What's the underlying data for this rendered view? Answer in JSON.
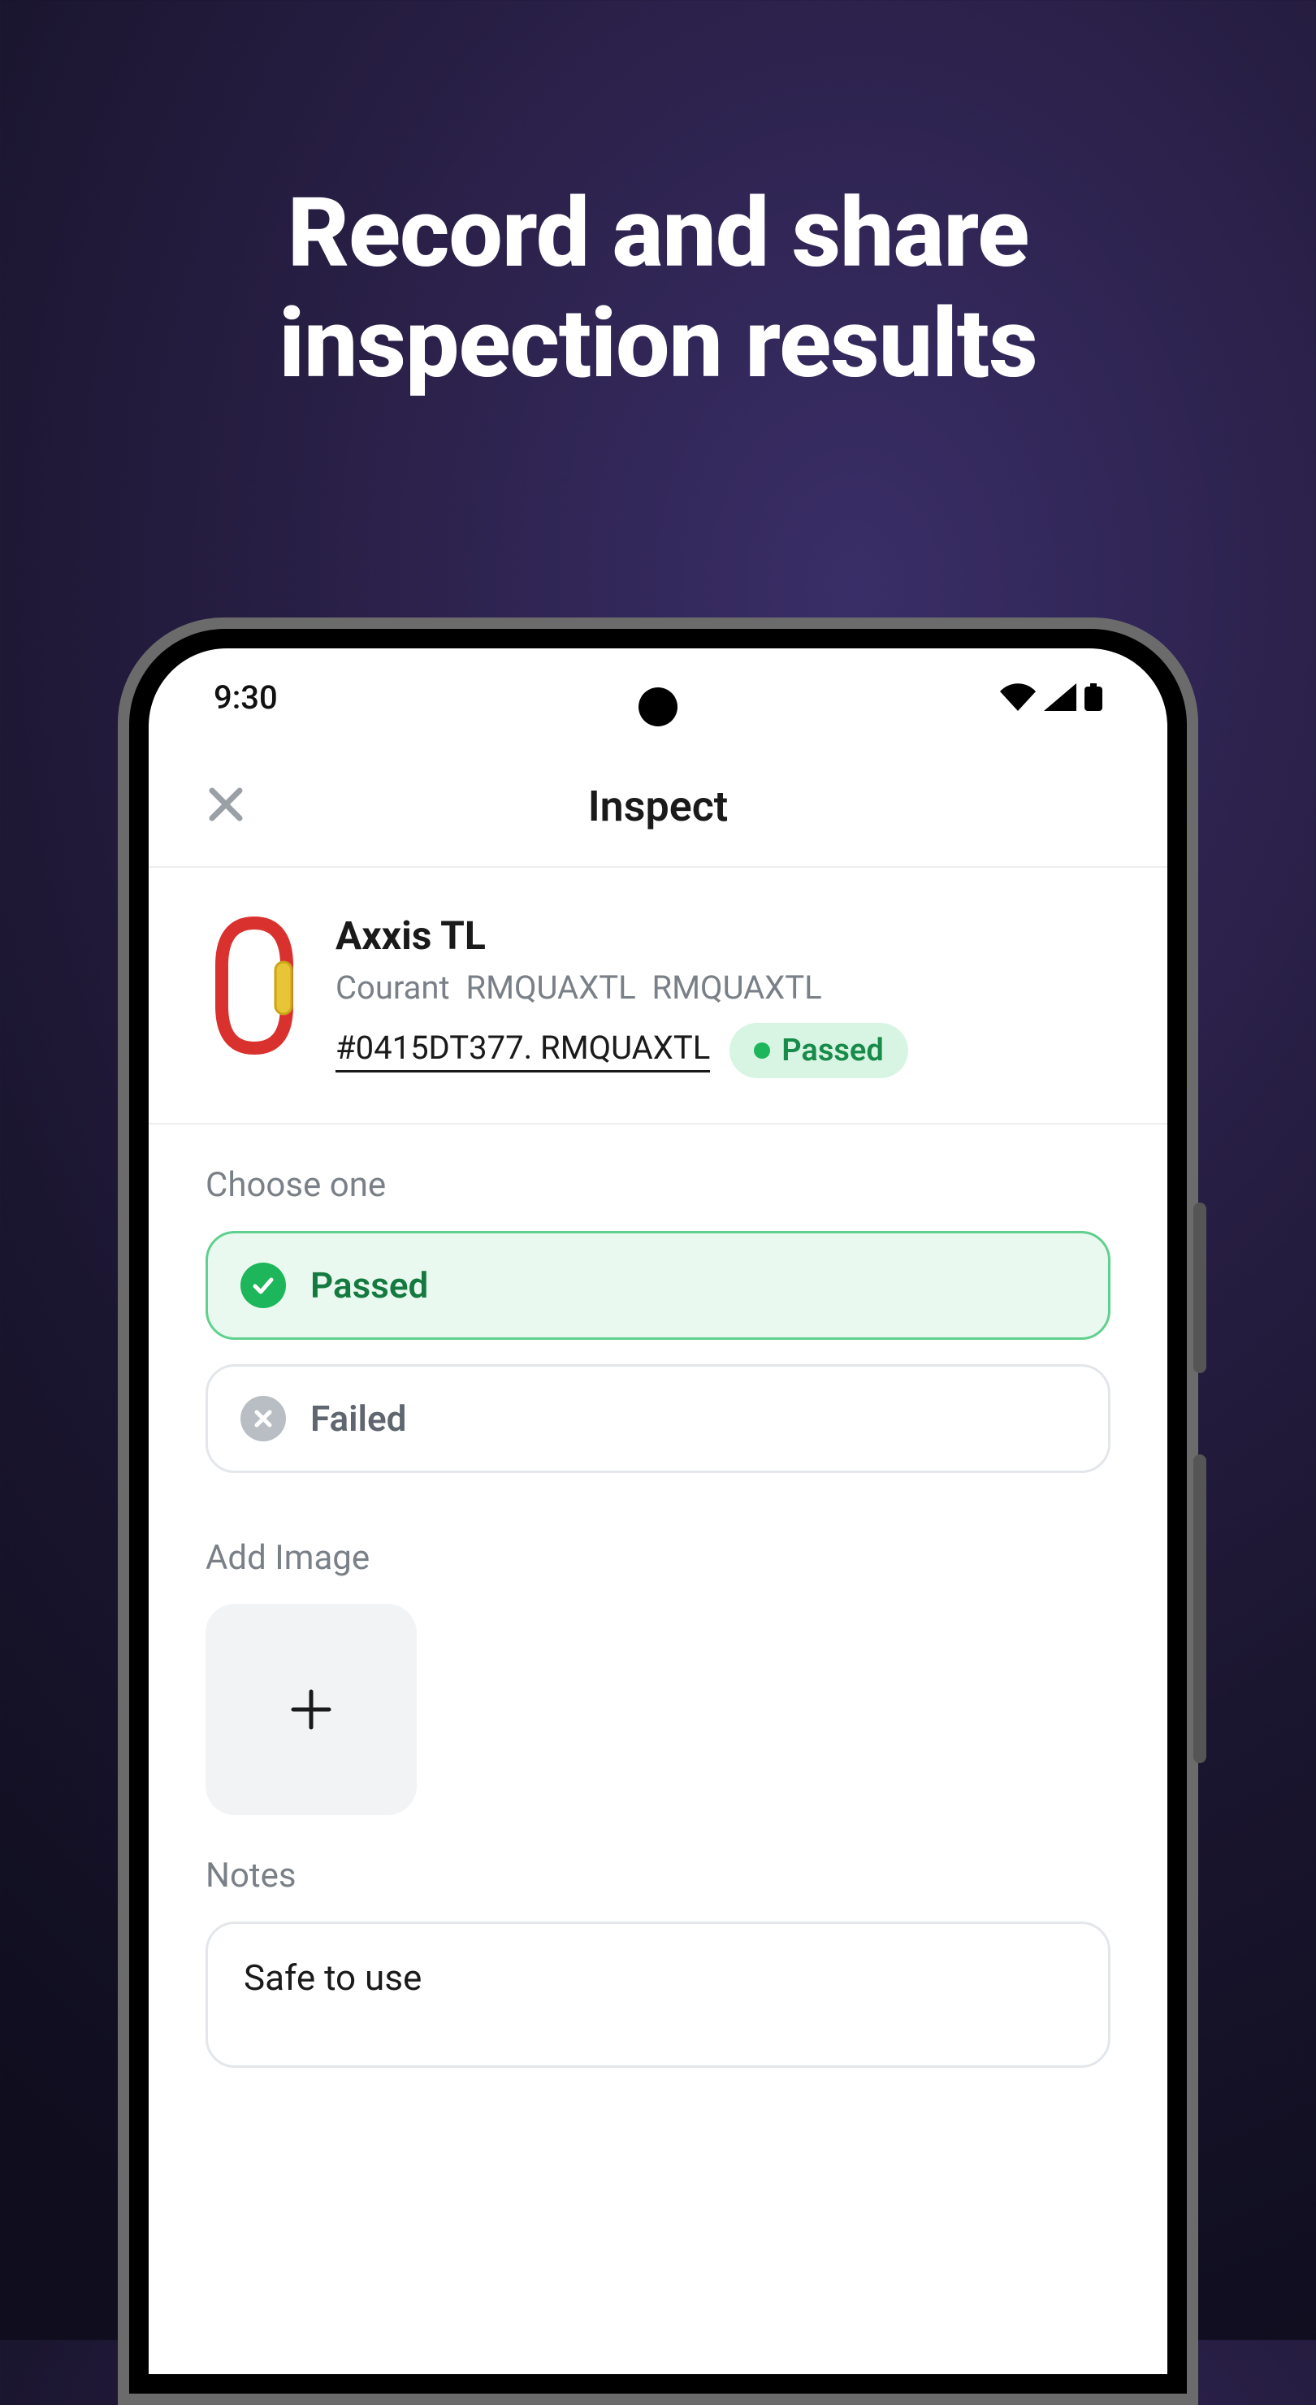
{
  "hero": {
    "line1": "Record and share",
    "line2": "inspection results"
  },
  "statusbar": {
    "time": "9:30"
  },
  "header": {
    "title": "Inspect"
  },
  "item": {
    "name": "Axxis TL",
    "brand": "Courant",
    "code1": "RMQUAXTL",
    "code2": "RMQUAXTL",
    "serial": "#0415DT377. RMQUAXTL",
    "status_label": "Passed"
  },
  "choose": {
    "label": "Choose one",
    "options": {
      "passed": "Passed",
      "failed": "Failed"
    }
  },
  "add_image": {
    "label": "Add Image"
  },
  "notes": {
    "label": "Notes",
    "value": "Safe to use"
  },
  "colors": {
    "accent_green": "#1db65a",
    "pill_bg": "#d8f5e3",
    "pill_text": "#188a4a"
  }
}
